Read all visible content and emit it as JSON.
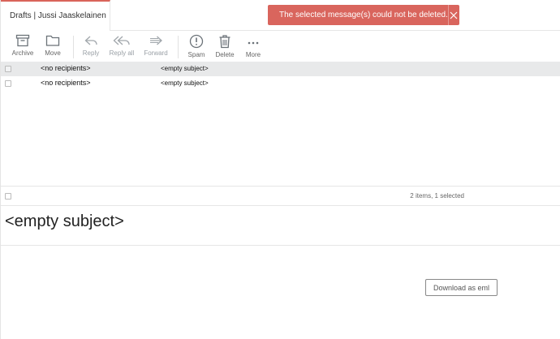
{
  "header": {
    "folder_title": "Drafts | Jussi Jaaskelainen"
  },
  "notification": {
    "message": "The selected message(s) could not be deleted.",
    "close_icon": "close-icon",
    "color": "#d9655d"
  },
  "toolbar": {
    "archive": "Archive",
    "move": "Move",
    "reply": "Reply",
    "reply_all": "Reply all",
    "forward": "Forward",
    "spam": "Spam",
    "delete": "Delete",
    "more": "More"
  },
  "messages": [
    {
      "from": "<no recipients>",
      "subject": "<empty subject>",
      "selected": true
    },
    {
      "from": "<no recipients>",
      "subject": "<empty subject>",
      "selected": false
    }
  ],
  "list_footer": {
    "count": "2 items, 1 selected"
  },
  "preview": {
    "subject": "<empty subject>",
    "download_label": "Download as eml"
  },
  "colors": {
    "accent": "#d9645a",
    "selected_row": "#e8e9ea"
  }
}
